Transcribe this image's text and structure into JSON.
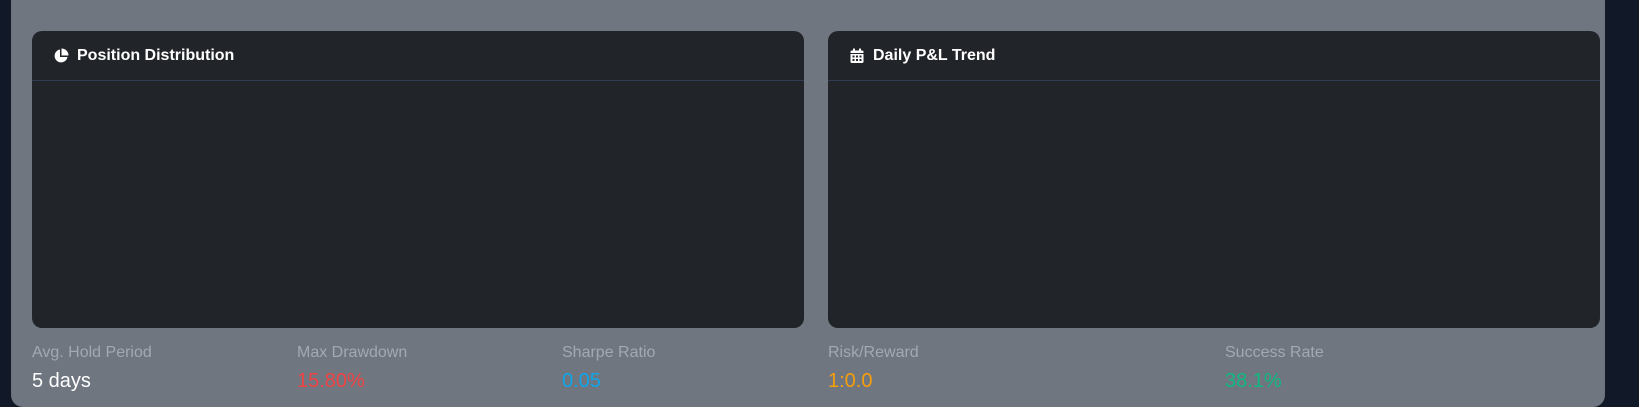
{
  "panels": {
    "position_distribution": {
      "title": "Position Distribution",
      "icon": "pie-chart-icon"
    },
    "daily_pnl_trend": {
      "title": "Daily P&L Trend",
      "icon": "calendar-icon"
    }
  },
  "stats": {
    "avg_hold_period": {
      "label": "Avg. Hold Period",
      "value": "5 days",
      "color": "#ffffff"
    },
    "max_drawdown": {
      "label": "Max Drawdown",
      "value": "15.80%",
      "color": "#ef4444"
    },
    "sharpe_ratio": {
      "label": "Sharpe Ratio",
      "value": "0.05",
      "color": "#0ea5e9"
    },
    "risk_reward": {
      "label": "Risk/Reward",
      "value": "1:0.0",
      "color": "#f59e0b"
    },
    "success_rate": {
      "label": "Success Rate",
      "value": "38.1%",
      "color": "#10b981"
    }
  }
}
